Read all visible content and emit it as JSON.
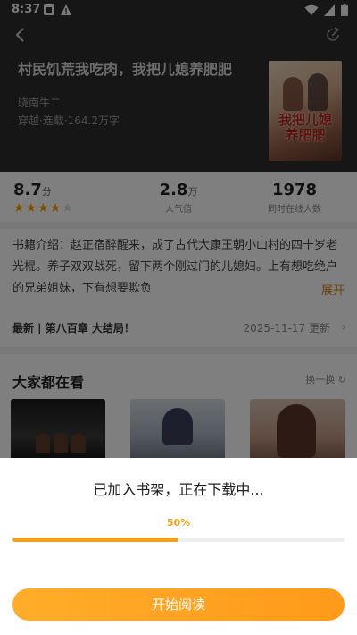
{
  "status_bar": {
    "time": "8:37"
  },
  "book": {
    "title": "村民饥荒我吃肉，我把儿媳养肥肥",
    "author": "晓南牛二",
    "meta": "穿越·连载·164.2万字",
    "cover_text": "我把儿媳养肥肥"
  },
  "stats": {
    "rating": "8.7",
    "rating_unit": "分",
    "stars": 4,
    "popularity": "2.8",
    "popularity_unit": "万",
    "popularity_label": "人气值",
    "online": "1978",
    "online_label": "同时在线人数"
  },
  "intro": {
    "text": "书籍介绍：赵正宿醉醒来，成了古代大康王朝小山村的四十岁老光棍。养子双双战死，留下两个刚过门的儿媳妇。上有想吃绝户的兄弟姐妹，下有想要欺负",
    "expand_label": "展开"
  },
  "latest": {
    "chapter": "最新 | 第八百章 大结局！",
    "date": "2025-11-17 更新"
  },
  "recommend": {
    "title": "大家都在看",
    "refresh_label": "换一换"
  },
  "sheet": {
    "title": "已加入书架，正在下载中...",
    "progress_text": "50%",
    "progress": 0.5,
    "button_label": "开始阅读"
  },
  "colors": {
    "accent": "#f0a020"
  }
}
